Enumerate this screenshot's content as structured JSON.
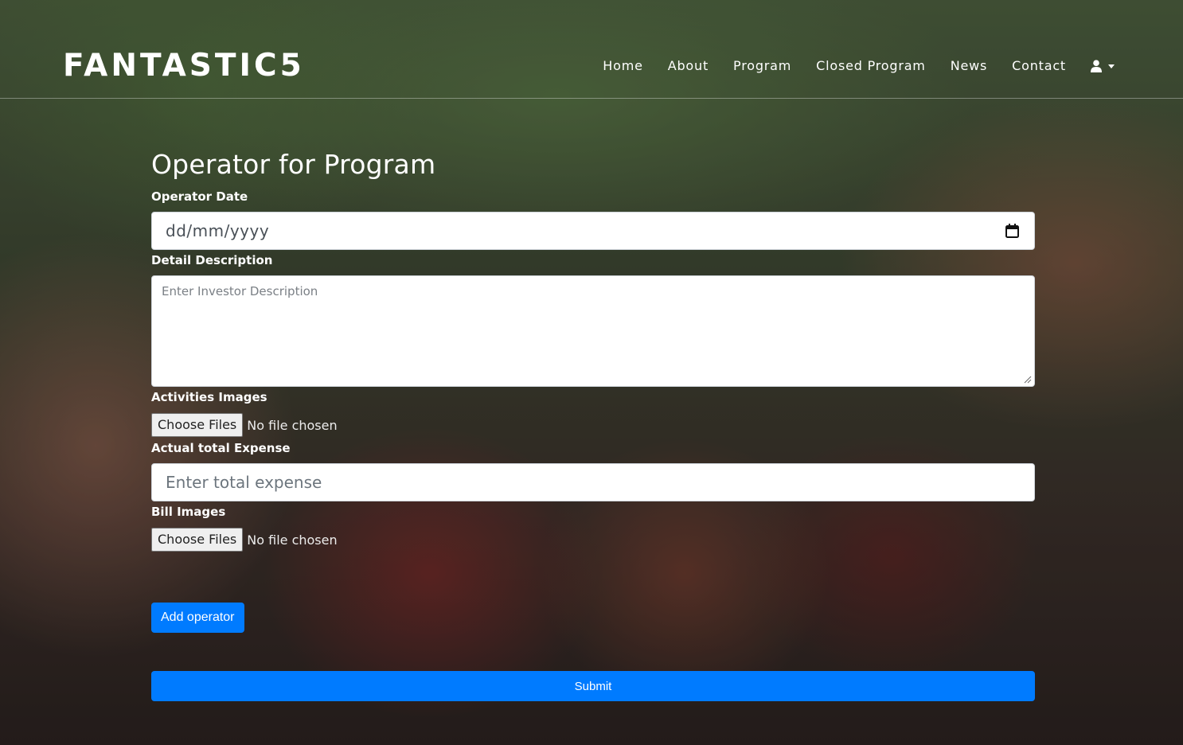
{
  "brand": "FANTASTIC5",
  "nav": {
    "items": [
      "Home",
      "About",
      "Program",
      "Closed Program",
      "News",
      "Contact"
    ],
    "user_icon": "user-icon"
  },
  "form": {
    "title": "Operator for Program",
    "operator_date": {
      "label": "Operator Date",
      "placeholder": "dd/mm/yyyy"
    },
    "detail_description": {
      "label": "Detail Description",
      "placeholder": "Enter Investor Description"
    },
    "activities_images": {
      "label": "Activities Images",
      "button": "Choose Files",
      "status": "No file chosen"
    },
    "actual_total_expense": {
      "label": "Actual total Expense",
      "placeholder": "Enter total expense"
    },
    "bill_images": {
      "label": "Bill Images",
      "button": "Choose Files",
      "status": "No file chosen"
    },
    "add_operator_label": "Add operator",
    "submit_label": "Submit"
  },
  "colors": {
    "primary": "#007bff",
    "text": "#ffffff"
  }
}
